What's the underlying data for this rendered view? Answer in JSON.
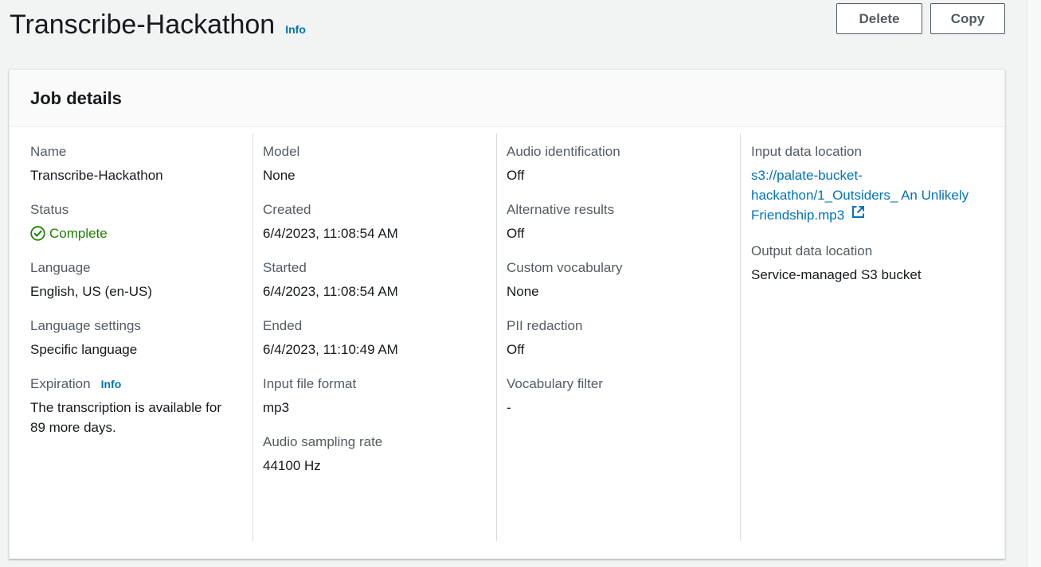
{
  "header": {
    "title": "Transcribe-Hackathon",
    "info_label": "Info",
    "delete_label": "Delete",
    "copy_label": "Copy"
  },
  "job_details": {
    "title": "Job details",
    "columns": [
      [
        {
          "label": "Name",
          "value": "Transcribe-Hackathon"
        },
        {
          "label": "Status",
          "value": "Complete"
        },
        {
          "label": "Language",
          "value": "English, US (en-US)"
        },
        {
          "label": "Language settings",
          "value": "Specific language"
        },
        {
          "label": "Expiration",
          "info": "Info",
          "value": "The transcription is available for 89 more days."
        }
      ],
      [
        {
          "label": "Model",
          "value": "None"
        },
        {
          "label": "Created",
          "value": "6/4/2023, 11:08:54 AM"
        },
        {
          "label": "Started",
          "value": "6/4/2023, 11:08:54 AM"
        },
        {
          "label": "Ended",
          "value": "6/4/2023, 11:10:49 AM"
        },
        {
          "label": "Input file format",
          "value": "mp3"
        },
        {
          "label": "Audio sampling rate",
          "value": "44100 Hz"
        }
      ],
      [
        {
          "label": "Audio identification",
          "value": "Off"
        },
        {
          "label": "Alternative results",
          "value": "Off"
        },
        {
          "label": "Custom vocabulary",
          "value": "None"
        },
        {
          "label": "PII redaction",
          "value": "Off"
        },
        {
          "label": "Vocabulary filter",
          "value": "-"
        }
      ],
      [
        {
          "label": "Input data location",
          "value": "s3://palate-bucket-hackathon/1_Outsiders_ An Unlikely Friendship.mp3"
        },
        {
          "label": "Output data location",
          "value": "Service-managed S3 bucket"
        }
      ]
    ]
  },
  "colors": {
    "link": "#0073bb",
    "success": "#1d8102",
    "text": "#16191f",
    "label": "#545b64",
    "background": "#f2f3f3"
  },
  "icons": {
    "status": "check-circle-icon",
    "external": "external-link-icon"
  }
}
